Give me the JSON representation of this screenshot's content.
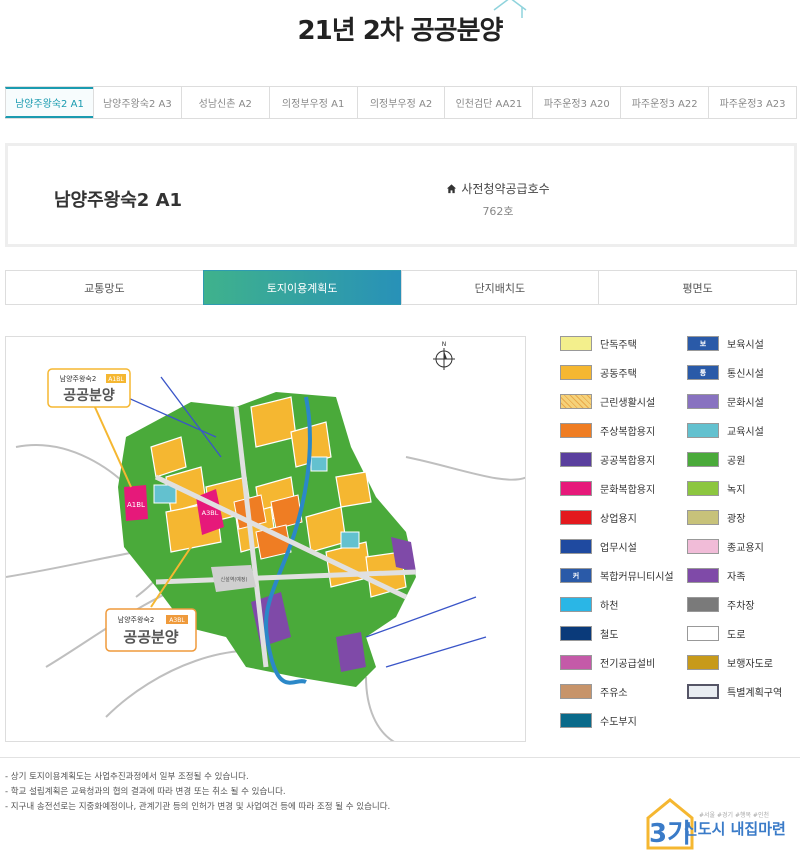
{
  "page": {
    "title": "21년 2차 공공분양"
  },
  "tabs": [
    {
      "label": "남양주왕숙2 A1",
      "active": true
    },
    {
      "label": "남양주왕숙2 A3",
      "active": false
    },
    {
      "label": "성남신촌 A2",
      "active": false
    },
    {
      "label": "의정부우정 A1",
      "active": false
    },
    {
      "label": "의정부우정 A2",
      "active": false
    },
    {
      "label": "인천검단 AA21",
      "active": false
    },
    {
      "label": "파주운정3 A20",
      "active": false
    },
    {
      "label": "파주운정3 A22",
      "active": false
    },
    {
      "label": "파주운정3 A23",
      "active": false
    }
  ],
  "info": {
    "name": "남양주왕숙2 A1",
    "supply_label": "사전청약공급호수",
    "supply_value": "762호",
    "supply_icon": "home-icon"
  },
  "subtabs": [
    {
      "label": "교통망도",
      "active": false
    },
    {
      "label": "토지이용계획도",
      "active": true
    },
    {
      "label": "단지배치도",
      "active": false
    },
    {
      "label": "평면도",
      "active": false
    }
  ],
  "map": {
    "callout_a1": {
      "title": "남양주왕숙2",
      "code": "A1BL",
      "text": "공공분양"
    },
    "callout_a3": {
      "title": "남양주왕숙2",
      "code": "A3BL",
      "text": "공공분양"
    },
    "parcel_a1": "A1BL",
    "parcel_a3": "A3BL",
    "compass": "N",
    "road_label": "신설역(예정)",
    "colors": {
      "residential": "#f5b731",
      "green": "#4aaa3a",
      "park_light": "#8fcf4f",
      "culture_mixed": "#e6197a",
      "public_mixed": "#6a3f9e",
      "commercial": "#ef7d23",
      "school": "#5bc1cf",
      "road": "#cfcfcf",
      "river": "#2b88c8",
      "line_blue": "#3a55c8"
    }
  },
  "legend": [
    {
      "label": "단독주택",
      "color": "#f3ef8c",
      "mark": ""
    },
    {
      "label": "보육시설",
      "color": "#2a5aa8",
      "mark": "보"
    },
    {
      "label": "공동주택",
      "color": "#f5b731",
      "mark": ""
    },
    {
      "label": "통신시설",
      "color": "#2a5aa8",
      "mark": "통"
    },
    {
      "label": "근린생활시설",
      "color": "#f5d27a",
      "mark": ""
    },
    {
      "label": "문화시설",
      "color": "#8872c0",
      "mark": ""
    },
    {
      "label": "주상복합용지",
      "color": "#ef7d23",
      "mark": ""
    },
    {
      "label": "교육시설",
      "color": "#63c1cf",
      "mark": ""
    },
    {
      "label": "공공복합용지",
      "color": "#5a3f9e",
      "mark": ""
    },
    {
      "label": "공원",
      "color": "#4aaa3a",
      "mark": ""
    },
    {
      "label": "문화복합용지",
      "color": "#e6197a",
      "mark": ""
    },
    {
      "label": "녹지",
      "color": "#8cc63f",
      "mark": ""
    },
    {
      "label": "상업용지",
      "color": "#e3191e",
      "mark": ""
    },
    {
      "label": "광장",
      "color": "#c7c27a",
      "mark": ""
    },
    {
      "label": "업무시설",
      "color": "#1f4aa0",
      "mark": ""
    },
    {
      "label": "종교용지",
      "color": "#f1bcd8",
      "mark": ""
    },
    {
      "label": "복합커뮤니티시설",
      "color": "#2a5aa8",
      "mark": "커"
    },
    {
      "label": "자족",
      "color": "#7f4aa8",
      "mark": ""
    },
    {
      "label": "하천",
      "color": "#2ab6e6",
      "mark": ""
    },
    {
      "label": "주차장",
      "color": "#7a7a7a",
      "mark": ""
    },
    {
      "label": "철도",
      "color": "#0a3a7a",
      "mark": ""
    },
    {
      "label": "도로",
      "color": "#ffffff",
      "mark": ""
    },
    {
      "label": "전기공급설비",
      "color": "#c45aa8",
      "mark": ""
    },
    {
      "label": "보행자도로",
      "color": "#c79a1a",
      "mark": ""
    },
    {
      "label": "주유소",
      "color": "#c7946a",
      "mark": ""
    },
    {
      "label": "특별계획구역",
      "color": "#e9edf2",
      "mark": ""
    },
    {
      "label": "수도부지",
      "color": "#0a6a8a",
      "mark": ""
    }
  ],
  "notes": [
    "- 상기 토지이용계획도는 사업추진과정에서 일부 조정될 수 있습니다.",
    "- 학교 설립계획은 교육청과의 협의 결과에 따라 변경 또는 취소 될 수 있습니다.",
    "- 지구내 송전선로는 지중화예정이나, 관계기관 등의 인허가 변경 및 사업여건 등에 따라 조정 될 수 있습니다."
  ],
  "brand": {
    "number": "3기",
    "tags": "#서울 #경기 #행복 #인천",
    "text": "신도시 내집마련"
  }
}
